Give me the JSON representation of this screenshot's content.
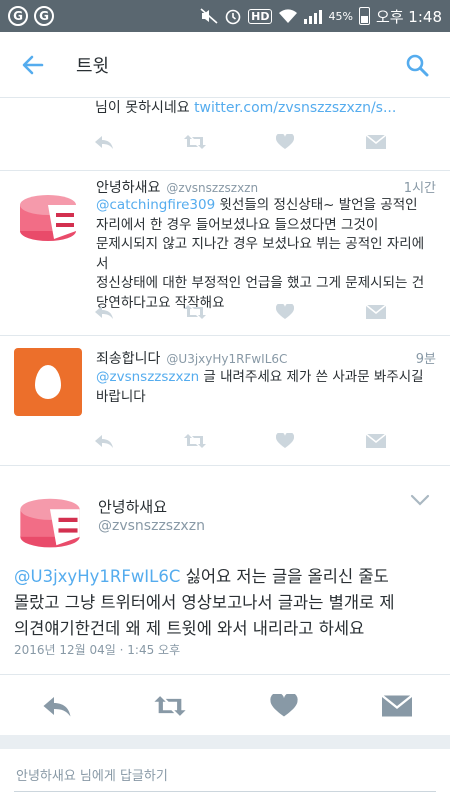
{
  "status_bar": {
    "left_icons": [
      "G",
      "G"
    ],
    "hd": "HD",
    "battery": "45%",
    "time": "오후 1:48"
  },
  "app_bar": {
    "title": "트윗",
    "back_icon": "arrow-left-icon",
    "search_icon": "search-icon"
  },
  "tweets": [
    {
      "truncated_text_prefix": "님이 못하시네요 ",
      "truncated_link": "twitter.com/zvsnszzszxzn/s..."
    },
    {
      "name": "안녕하새요",
      "handle": "@zvsnszzszxzn",
      "time": "1시간",
      "mention": "@catchingfire309",
      "body_first": " 윗선들의 정신상태~ 발언을 공적인",
      "body_lines": [
        "자리에서 한 경우 들어보셨나요 들으셨다면 그것이",
        "문제시되지 않고 지나간 경우 보셨나요 뷔는 공적인 자리에서",
        "정신상태에 대한 부정적인 언급을 했고 그게 문제시되는 건",
        "당연하다고요 작작해요"
      ]
    },
    {
      "name": "죄송합니다",
      "handle": "@U3jxyHy1RFwIL6C",
      "time": "9분",
      "mention": "@zvsnszzszxzn",
      "body_first": " 글 내려주세요 제가 쓴 사과문 봐주시길",
      "body_lines": [
        "바랍니다"
      ]
    }
  ],
  "main_tweet": {
    "name": "안녕하새요",
    "handle": "@zvsnszzszxzn",
    "mention": "@U3jxyHy1RFwIL6C",
    "text_first": " 싫어요 저는 글을 올리신 줄도",
    "text_lines": [
      "몰랐고 그냥 트위터에서 영상보고나서 글과는 별개로 제",
      "의견얘기한건데 왜 제 트윗에 와서 내리라고 하세요"
    ],
    "date": "2016년 12월 04일 · 1:45 오후"
  },
  "reply_bar": {
    "placeholder": "안녕하새요 님에게 답글하기"
  },
  "colors": {
    "accent": "#55acee",
    "status_bar": "#5a6770",
    "egg_avatar": "#ec6f2b"
  }
}
